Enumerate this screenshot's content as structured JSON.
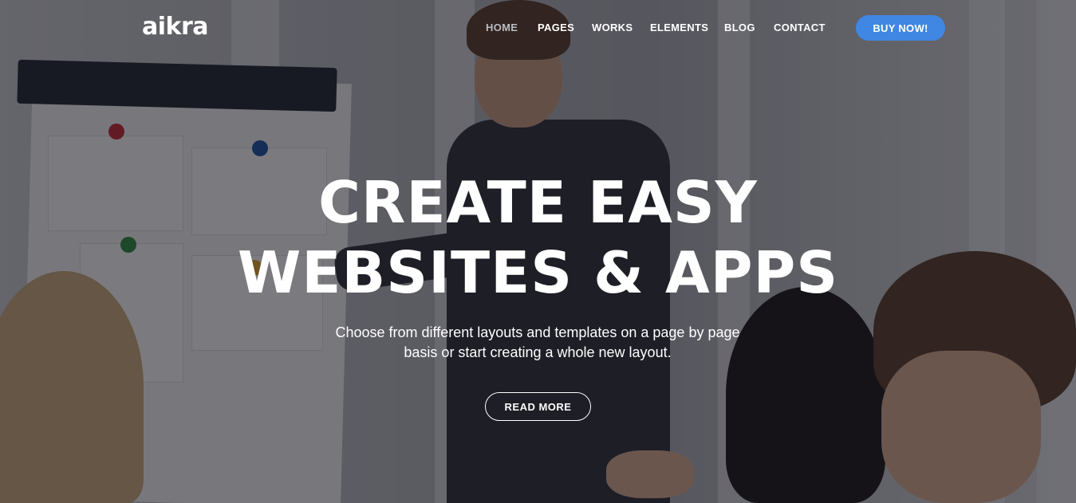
{
  "logo": {
    "text": "aikra"
  },
  "nav": {
    "items": [
      {
        "label": "HOME",
        "active": true
      },
      {
        "label": "PAGES",
        "active": false
      },
      {
        "label": "WORKS",
        "active": false
      },
      {
        "label": "ELEMENTS",
        "active": false
      },
      {
        "label": "BLOG",
        "active": false
      },
      {
        "label": "CONTACT",
        "active": false
      }
    ],
    "cta_label": "BUY NOW!"
  },
  "hero": {
    "headline_line1": "CREATE EASY",
    "headline_line2": "WEBSITES & APPS",
    "subtitle_line1": "Choose from different layouts and templates on a page by page",
    "subtitle_line2": "basis or start creating a whole new layout.",
    "button_label": "READ MORE",
    "background_image": "business-presentation-photo"
  },
  "colors": {
    "accent": "#3f87e3",
    "text": "#ffffff",
    "nav_active": "#b9bbc3"
  }
}
